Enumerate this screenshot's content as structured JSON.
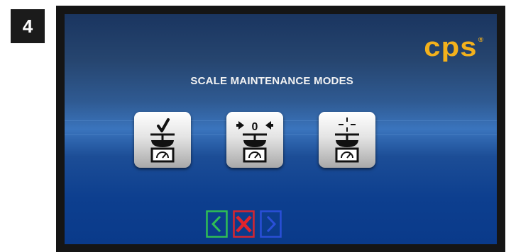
{
  "step": {
    "number": "4"
  },
  "screen": {
    "brand": {
      "text": "cps",
      "registered": "®",
      "color": "#f3b11c"
    },
    "title": "SCALE MAINTENANCE MODES",
    "modes": [
      {
        "icon": "scale-check-icon"
      },
      {
        "icon": "scale-zero-icon",
        "zero_label": "0"
      },
      {
        "icon": "scale-calibrate-icon"
      }
    ],
    "navigation": {
      "back_icon": "chevron-left-icon",
      "cancel_icon": "close-x-icon",
      "next_icon": "chevron-right-icon",
      "colors": {
        "back": "#2fbf55",
        "cancel": "#d8262f",
        "next": "#2a4fd8"
      }
    }
  }
}
